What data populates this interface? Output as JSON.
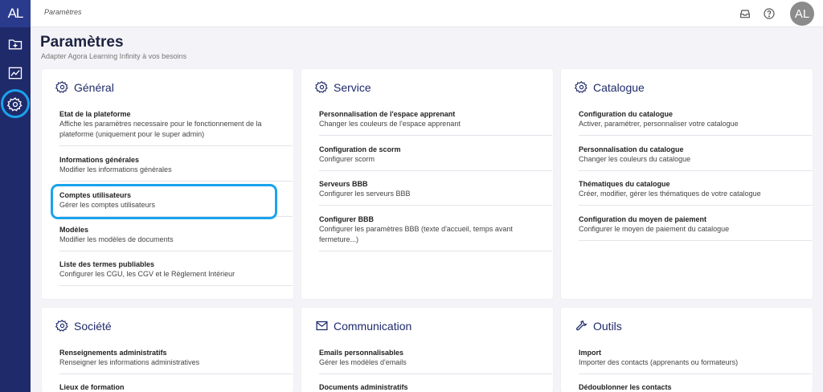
{
  "app": {
    "logo": "AL"
  },
  "breadcrumb": "Paramètres",
  "user": {
    "initials": "AL"
  },
  "page": {
    "title": "Paramètres",
    "subtitle": "Adapter Agora Learning Infinity à vos besoins"
  },
  "cards": {
    "general": {
      "title": "Général",
      "items": [
        {
          "title": "Etat de la plateforme",
          "desc": "Affiche les paramètres necessaire pour le fonctionnement de la plateforme (uniquement pour le super admin)"
        },
        {
          "title": "Informations générales",
          "desc": "Modifier les informations générales"
        },
        {
          "title": "Comptes utilisateurs",
          "desc": "Gérer les comptes utilisateurs"
        },
        {
          "title": "Modèles",
          "desc": "Modifier les modèles de documents"
        },
        {
          "title": "Liste des termes publiables",
          "desc": "Configurer les CGU, les CGV et le Règlement Intérieur"
        }
      ]
    },
    "service": {
      "title": "Service",
      "items": [
        {
          "title": "Personnalisation de l'espace apprenant",
          "desc": "Changer les couleurs de l'espace apprenant"
        },
        {
          "title": "Configuration de scorm",
          "desc": "Configurer scorm"
        },
        {
          "title": "Serveurs BBB",
          "desc": "Configurer les serveurs BBB"
        },
        {
          "title": "Configurer BBB",
          "desc": "Configurer les paramètres BBB (texte d'accueil, temps avant fermeture...)"
        }
      ]
    },
    "catalogue": {
      "title": "Catalogue",
      "items": [
        {
          "title": "Configuration du catalogue",
          "desc": "Activer, paramétrer, personnaliser votre catalogue"
        },
        {
          "title": "Personnalisation du catalogue",
          "desc": "Changer les couleurs du catalogue"
        },
        {
          "title": "Thématiques du catalogue",
          "desc": "Créer, modifier, gérer les thématiques de votre catalogue"
        },
        {
          "title": "Configuration du moyen de paiement",
          "desc": "Configurer le moyen de paiement du catalogue"
        }
      ]
    },
    "societe": {
      "title": "Société",
      "items": [
        {
          "title": "Renseignements administratifs",
          "desc": "Renseigner les informations administratives"
        },
        {
          "title": "Lieux de formation"
        }
      ]
    },
    "communication": {
      "title": "Communication",
      "items": [
        {
          "title": "Emails personnalisables",
          "desc": "Gérer les modèles d'emails"
        },
        {
          "title": "Documents administratifs"
        }
      ]
    },
    "outils": {
      "title": "Outils",
      "items": [
        {
          "title": "Import",
          "desc": "Importer des contacts (apprenants ou formateurs)"
        },
        {
          "title": "Dédoublonner les contacts"
        }
      ]
    }
  }
}
